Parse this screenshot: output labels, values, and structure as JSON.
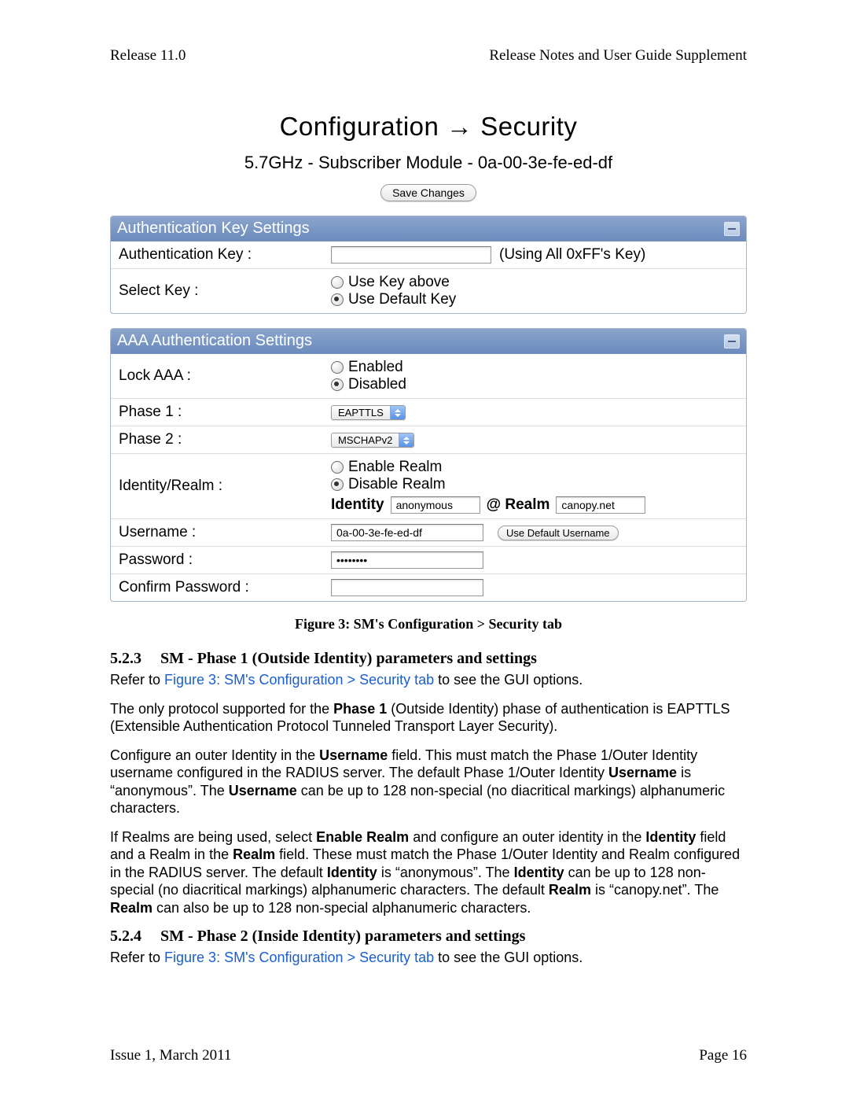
{
  "doc": {
    "release": "Release 11.0",
    "header_right": "Release Notes and User Guide Supplement",
    "issue": "Issue 1, March 2011",
    "page": "Page 16"
  },
  "title": {
    "main_left": "Configuration",
    "arrow": "→",
    "main_right": "Security",
    "sub": "5.7GHz - Subscriber Module - 0a-00-3e-fe-ed-df"
  },
  "save_btn": "Save Changes",
  "panels": {
    "auth_key": {
      "title": "Authentication Key Settings",
      "rows": {
        "auth_key_label": "Authentication Key :",
        "auth_key_hint": "(Using All 0xFF's Key)",
        "select_key_label": "Select Key :",
        "select_key_opts": [
          "Use Key above",
          "Use Default Key"
        ],
        "select_key_checked": 1
      }
    },
    "aaa": {
      "title": "AAA Authentication Settings",
      "lock_label": "Lock AAA :",
      "lock_opts": [
        "Enabled",
        "Disabled"
      ],
      "lock_checked": 1,
      "phase1_label": "Phase 1 :",
      "phase1_value": "EAPTTLS",
      "phase2_label": "Phase 2 :",
      "phase2_value": "MSCHAPv2",
      "identity_label": "Identity/Realm :",
      "realm_opts": [
        "Enable Realm",
        "Disable Realm"
      ],
      "realm_checked": 1,
      "identity_word": "Identity",
      "identity_value": "anonymous",
      "at_realm": "@ Realm",
      "realm_value": "canopy.net",
      "username_label": "Username :",
      "username_value": "0a-00-3e-fe-ed-df",
      "username_btn": "Use Default Username",
      "password_label": "Password :",
      "password_value": "••••••••",
      "confirm_label": "Confirm Password :",
      "confirm_value": ""
    }
  },
  "caption": "Figure 3: SM's Configuration > Security tab",
  "sections": {
    "s523": {
      "num": "5.2.3",
      "title": "SM - Phase 1 (Outside Identity) parameters and settings",
      "ref_prefix": "Refer to ",
      "ref_link": "Figure 3: SM's Configuration > Security tab",
      "ref_suffix": " to see the GUI options.",
      "p2_a": "The only protocol supported for the ",
      "p2_b": "Phase 1",
      "p2_c": " (Outside Identity) phase of authentication is EAPTTLS (Extensible Authentication Protocol Tunneled Transport Layer Security).",
      "p3_a": "Configure an outer Identity in the ",
      "p3_b": "Username",
      "p3_c": " field. This must match the Phase 1/Outer Identity username configured in the RADIUS server. The default Phase 1/Outer Identity ",
      "p3_d": "Username",
      "p3_e": " is “anonymous”. The ",
      "p3_f": "Username",
      "p3_g": " can be up to 128 non-special (no diacritical markings) alphanumeric characters.",
      "p4_a": "If Realms are being used, select ",
      "p4_b": "Enable Realm",
      "p4_c": " and configure an outer identity in the ",
      "p4_d": "Identity",
      "p4_e": " field and a Realm in the ",
      "p4_f": "Realm",
      "p4_g": " field. These must match the Phase 1/Outer Identity and Realm configured in the RADIUS server. The default ",
      "p4_h": "Identity",
      "p4_i": " is “anonymous”. The ",
      "p4_j": "Identity",
      "p4_k": " can be up to 128 non-special (no diacritical markings) alphanumeric characters. The default ",
      "p4_l": "Realm",
      "p4_m": " is “canopy.net”. The ",
      "p4_n": "Realm",
      "p4_o": " can also be up to 128 non-special alphanumeric characters."
    },
    "s524": {
      "num": "5.2.4",
      "title": "SM - Phase 2 (Inside Identity) parameters and settings",
      "ref_prefix": "Refer to ",
      "ref_link": "Figure 3: SM's Configuration > Security tab",
      "ref_suffix": " to see the GUI options."
    }
  }
}
